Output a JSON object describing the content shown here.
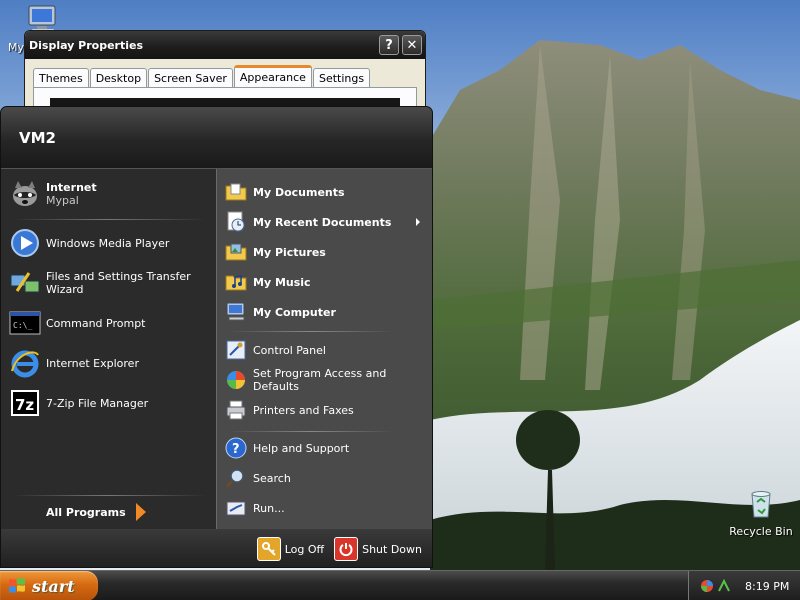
{
  "desktop": {
    "my_computer_label": "My",
    "recycle_bin_label": "Recycle Bin"
  },
  "display_properties": {
    "title": "Display Properties",
    "help_label": "?",
    "close_label": "✕",
    "tabs": [
      {
        "label": "Themes",
        "active": false
      },
      {
        "label": "Desktop",
        "active": false
      },
      {
        "label": "Screen Saver",
        "active": false
      },
      {
        "label": "Appearance",
        "active": true
      },
      {
        "label": "Settings",
        "active": false
      }
    ]
  },
  "start_menu": {
    "user_name": "VM2",
    "left_items": [
      {
        "title": "Internet",
        "subtitle": "Mypal",
        "icon": "raccoon-browser-icon"
      },
      {
        "title": "Windows Media Player",
        "icon": "media-player-icon"
      },
      {
        "title": "Files and Settings Transfer Wizard",
        "icon": "transfer-wizard-icon"
      },
      {
        "title": "Command Prompt",
        "icon": "command-prompt-icon"
      },
      {
        "title": "Internet Explorer",
        "icon": "internet-explorer-icon"
      },
      {
        "title": "7-Zip File Manager",
        "icon": "seven-zip-icon"
      }
    ],
    "all_programs_label": "All Programs",
    "right_items": [
      {
        "label": "My Documents",
        "bold": true,
        "icon": "folder-documents-icon"
      },
      {
        "label": "My Recent Documents",
        "bold": true,
        "icon": "recent-documents-icon",
        "submenu": true
      },
      {
        "label": "My Pictures",
        "bold": true,
        "icon": "folder-pictures-icon"
      },
      {
        "label": "My Music",
        "bold": true,
        "icon": "folder-music-icon"
      },
      {
        "label": "My Computer",
        "bold": true,
        "icon": "computer-icon"
      },
      {
        "label": "Control Panel",
        "bold": false,
        "icon": "control-panel-icon"
      },
      {
        "label": "Set Program Access and Defaults",
        "bold": false,
        "icon": "program-defaults-icon"
      },
      {
        "label": "Printers and Faxes",
        "bold": false,
        "icon": "printer-icon"
      },
      {
        "label": "Help and Support",
        "bold": false,
        "icon": "help-icon"
      },
      {
        "label": "Search",
        "bold": false,
        "icon": "search-icon"
      },
      {
        "label": "Run...",
        "bold": false,
        "icon": "run-icon"
      }
    ],
    "log_off_label": "Log Off",
    "shut_down_label": "Shut Down"
  },
  "taskbar": {
    "start_label": "start",
    "clock": "8:19 PM"
  },
  "colors": {
    "start_button": "#d66a12",
    "active_tab_accent": "#e68b2c",
    "menu_dark": "#2b2b2b",
    "menu_right": "#4a4a4a"
  }
}
